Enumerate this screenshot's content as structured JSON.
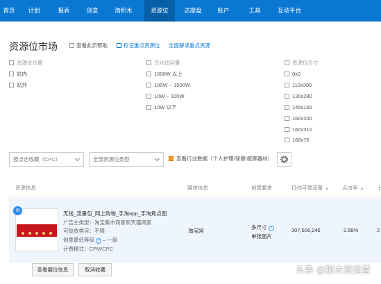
{
  "nav": {
    "items": [
      "首页",
      "计划",
      "报表",
      "创意",
      "淘积木",
      "资源位",
      "达摩盘",
      "账户",
      "工具",
      "互动平台"
    ],
    "active_index": 5,
    "bg_color": "#0a78d2"
  },
  "page": {
    "title": "资源位市场",
    "links": {
      "help": "查看此页帮助",
      "favorite": "标记重点资源位",
      "learn": "全面解读重点资源"
    }
  },
  "filters": {
    "position": {
      "label": "资源位位置",
      "options": [
        "站内",
        "站外"
      ]
    },
    "daily_visits": {
      "label": "日均访问量",
      "options": [
        "1000W 以上",
        "100W ~ 1000W",
        "10W ~ 100W",
        "10W 以下"
      ]
    },
    "size": {
      "label": "资源位尺寸",
      "options": [
        "0x0",
        "110x300",
        "130x280",
        "145x165",
        "160x200",
        "160x310",
        "168x76"
      ]
    }
  },
  "toolbar": {
    "sort_select": "按点击收藏（CPC）",
    "type_select": "全部资源位类型",
    "industry_checkbox": "查看行业数据",
    "industry_note": "（个人护理/保健/按摩器材）"
  },
  "table": {
    "headers": [
      "资源信息",
      "媒体信息",
      "创意要求",
      "日均可竞流量",
      "点击率",
      "上"
    ],
    "rows": [
      {
        "name": "无线_流量包_网上购物_手淘app_手淘焦点图",
        "ad_type": "广告主类型：淘宝集市商家和天猫商家",
        "category": "可投放类目：不限",
        "min_level_label": "创意最低等级",
        "min_level_value": "一级",
        "billing": "计费模式：CPM/CPC",
        "media": "淘宝网",
        "creative_size": "多尺寸",
        "creative_type": "单张图片",
        "daily_traffic": "307,506,245",
        "ctr": "2.58%",
        "trailing": "2"
      }
    ],
    "actions": {
      "view": "查看展位信息",
      "cancel": "取消收藏"
    }
  },
  "watermark": "头条 @那木说运营"
}
